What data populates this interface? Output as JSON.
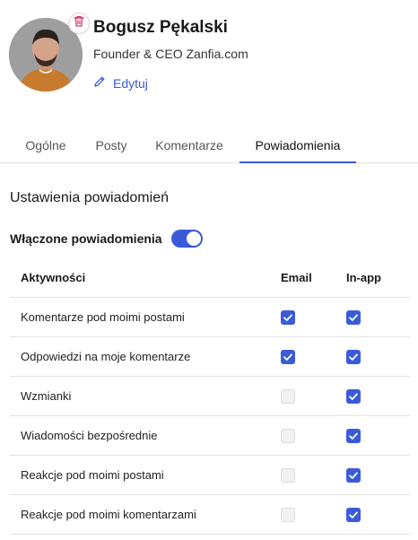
{
  "profile": {
    "name": "Bogusz Pękalski",
    "role": "Founder & CEO Zanfia.com",
    "edit_label": "Edytuj"
  },
  "tabs": [
    {
      "label": "Ogólne",
      "active": false
    },
    {
      "label": "Posty",
      "active": false
    },
    {
      "label": "Komentarze",
      "active": false
    },
    {
      "label": "Powiadomienia",
      "active": true
    }
  ],
  "notifications": {
    "section_title": "Ustawienia powiadomień",
    "toggle_label": "Włączone powiadomienia",
    "toggle_on": true,
    "columns": {
      "activity": "Aktywności",
      "email": "Email",
      "inapp": "In-app"
    },
    "rows": [
      {
        "label": "Komentarze pod moimi postami",
        "email": true,
        "inapp": true
      },
      {
        "label": "Odpowiedzi na moje komentarze",
        "email": true,
        "inapp": true
      },
      {
        "label": "Wzmianki",
        "email": false,
        "inapp": true
      },
      {
        "label": "Wiadomości bezpośrednie",
        "email": false,
        "inapp": true
      },
      {
        "label": "Reakcje pod moimi postami",
        "email": false,
        "inapp": true
      },
      {
        "label": "Reakcje pod moimi komentarzami",
        "email": false,
        "inapp": true
      }
    ]
  },
  "colors": {
    "accent": "#3a5bd9",
    "delete": "#d6336c"
  },
  "icons": {
    "delete": "trash-icon",
    "edit": "pencil-icon",
    "check": "check-icon"
  }
}
